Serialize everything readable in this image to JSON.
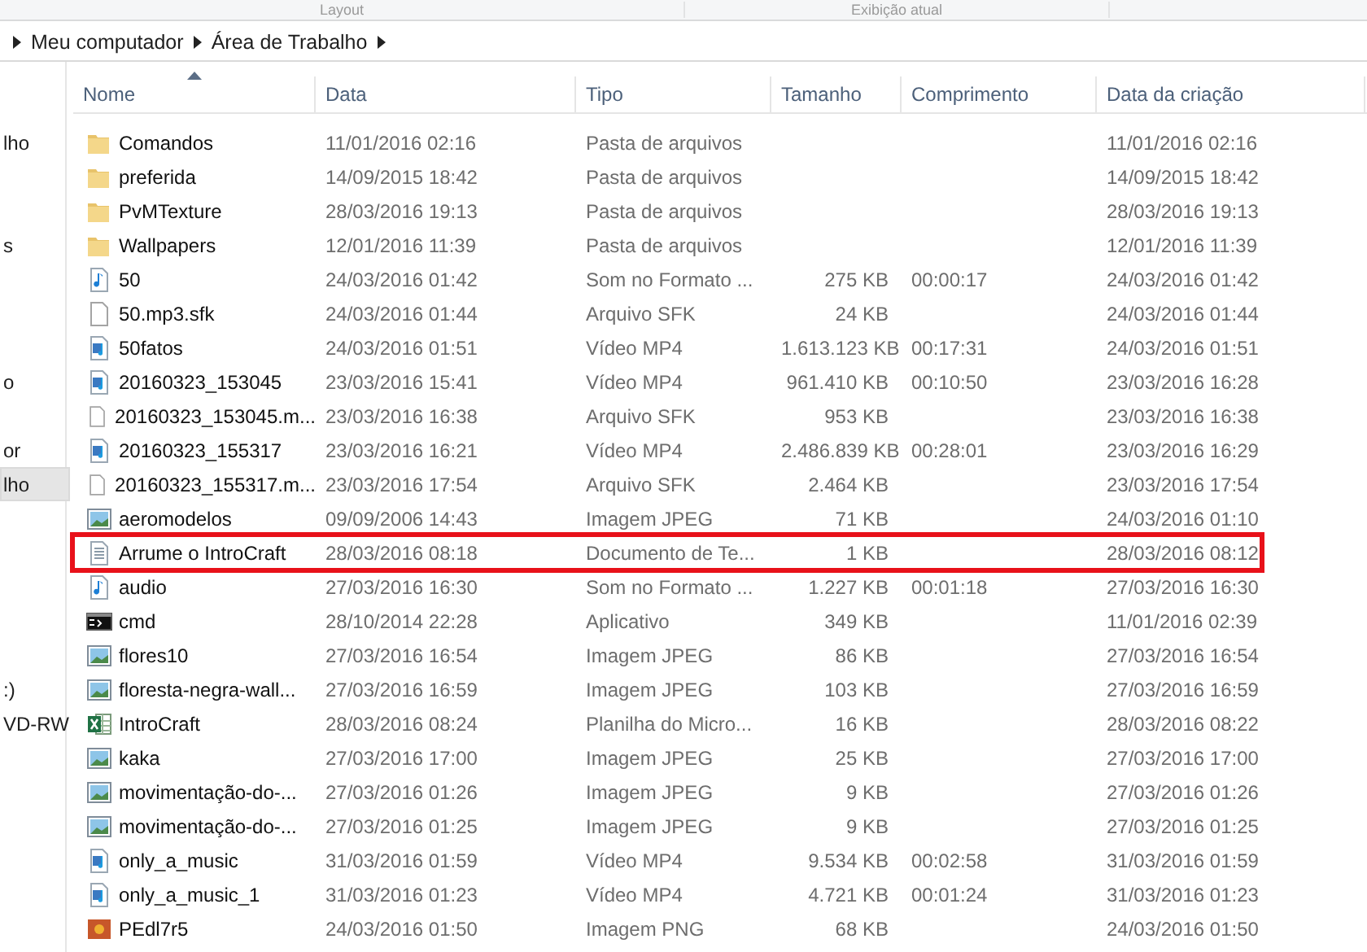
{
  "ribbon": {
    "groups": [
      "Layout",
      "Exibição atual"
    ]
  },
  "address_bar": {
    "crumbs": [
      "Meu computador",
      "Área de Trabalho"
    ]
  },
  "sidebar": {
    "items": [
      {
        "label": "lho",
        "selected": false
      },
      {
        "label": "s",
        "selected": false
      },
      {
        "label": "o",
        "selected": false
      },
      {
        "label": "or",
        "selected": false
      },
      {
        "label": "lho",
        "selected": true
      },
      {
        "label": ":)",
        "selected": false
      },
      {
        "label": "VD-RW",
        "selected": false
      }
    ]
  },
  "table": {
    "columns": [
      {
        "label": "Nome",
        "sorted": true
      },
      {
        "label": "Data",
        "sorted": false
      },
      {
        "label": "Tipo",
        "sorted": false
      },
      {
        "label": "Tamanho",
        "sorted": false
      },
      {
        "label": "Comprimento",
        "sorted": false
      },
      {
        "label": "Data da criação",
        "sorted": false
      }
    ],
    "rows": [
      {
        "kind": "folder",
        "name": "Comandos",
        "date": "11/01/2016 02:16",
        "type": "Pasta de arquivos",
        "created": "11/01/2016 02:16",
        "highlighted": false
      },
      {
        "kind": "folder",
        "name": "preferida",
        "date": "14/09/2015 18:42",
        "type": "Pasta de arquivos",
        "created": "14/09/2015 18:42",
        "highlighted": false
      },
      {
        "kind": "folder",
        "name": "PvMTexture",
        "date": "28/03/2016 19:13",
        "type": "Pasta de arquivos",
        "created": "28/03/2016 19:13",
        "highlighted": false
      },
      {
        "kind": "folder",
        "name": "Wallpapers",
        "date": "12/01/2016 11:39",
        "type": "Pasta de arquivos",
        "created": "12/01/2016 11:39",
        "highlighted": false
      },
      {
        "kind": "audio",
        "name": "50",
        "date": "24/03/2016 01:42",
        "type": "Som no Formato ...",
        "size": "275 KB",
        "length": "00:00:17",
        "created": "24/03/2016 01:42",
        "highlighted": false
      },
      {
        "kind": "blank",
        "name": "50.mp3.sfk",
        "date": "24/03/2016 01:44",
        "type": "Arquivo SFK",
        "size": "24 KB",
        "created": "24/03/2016 01:44",
        "highlighted": false
      },
      {
        "kind": "video",
        "name": "50fatos",
        "date": "24/03/2016 01:51",
        "type": "Vídeo MP4",
        "size": "1.613.123 KB",
        "length": "00:17:31",
        "created": "24/03/2016 01:51",
        "highlighted": false
      },
      {
        "kind": "video",
        "name": "20160323_153045",
        "date": "23/03/2016 15:41",
        "type": "Vídeo MP4",
        "size": "961.410 KB",
        "length": "00:10:50",
        "created": "23/03/2016 16:28",
        "highlighted": false
      },
      {
        "kind": "blank",
        "name": "20160323_153045.m...",
        "date": "23/03/2016 16:38",
        "type": "Arquivo SFK",
        "size": "953 KB",
        "created": "23/03/2016 16:38",
        "highlighted": false
      },
      {
        "kind": "video",
        "name": "20160323_155317",
        "date": "23/03/2016 16:21",
        "type": "Vídeo MP4",
        "size": "2.486.839 KB",
        "length": "00:28:01",
        "created": "23/03/2016 16:29",
        "highlighted": false
      },
      {
        "kind": "blank",
        "name": "20160323_155317.m...",
        "date": "23/03/2016 17:54",
        "type": "Arquivo SFK",
        "size": "2.464 KB",
        "created": "23/03/2016 17:54",
        "highlighted": false
      },
      {
        "kind": "image",
        "name": "aeromodelos",
        "date": "09/09/2006 14:43",
        "type": "Imagem JPEG",
        "size": "71 KB",
        "created": "24/03/2016 01:10",
        "highlighted": false
      },
      {
        "kind": "text",
        "name": "Arrume o IntroCraft",
        "date": "28/03/2016 08:18",
        "type": "Documento de Te...",
        "size": "1 KB",
        "created": "28/03/2016 08:12",
        "highlighted": true
      },
      {
        "kind": "audio",
        "name": "audio",
        "date": "27/03/2016 16:30",
        "type": "Som no Formato ...",
        "size": "1.227 KB",
        "length": "00:01:18",
        "created": "27/03/2016 16:30",
        "highlighted": false
      },
      {
        "kind": "console",
        "name": "cmd",
        "date": "28/10/2014 22:28",
        "type": "Aplicativo",
        "size": "349 KB",
        "created": "11/01/2016 02:39",
        "highlighted": false
      },
      {
        "kind": "image",
        "name": "flores10",
        "date": "27/03/2016 16:54",
        "type": "Imagem JPEG",
        "size": "86 KB",
        "created": "27/03/2016 16:54",
        "highlighted": false
      },
      {
        "kind": "image",
        "name": "floresta-negra-wall...",
        "date": "27/03/2016 16:59",
        "type": "Imagem JPEG",
        "size": "103 KB",
        "created": "27/03/2016 16:59",
        "highlighted": false
      },
      {
        "kind": "sheet",
        "name": "IntroCraft",
        "date": "28/03/2016 08:24",
        "type": "Planilha do Micro...",
        "size": "16 KB",
        "created": "28/03/2016 08:22",
        "highlighted": false
      },
      {
        "kind": "image",
        "name": "kaka",
        "date": "27/03/2016 17:00",
        "type": "Imagem JPEG",
        "size": "25 KB",
        "created": "27/03/2016 17:00",
        "highlighted": false
      },
      {
        "kind": "image",
        "name": "movimentação-do-...",
        "date": "27/03/2016 01:26",
        "type": "Imagem JPEG",
        "size": "9 KB",
        "created": "27/03/2016 01:26",
        "highlighted": false
      },
      {
        "kind": "image",
        "name": "movimentação-do-...",
        "date": "27/03/2016 01:25",
        "type": "Imagem JPEG",
        "size": "9 KB",
        "created": "27/03/2016 01:25",
        "highlighted": false
      },
      {
        "kind": "video",
        "name": "only_a_music",
        "date": "31/03/2016 01:59",
        "type": "Vídeo MP4",
        "size": "9.534 KB",
        "length": "00:02:58",
        "created": "31/03/2016 01:59",
        "highlighted": false
      },
      {
        "kind": "video",
        "name": "only_a_music_1",
        "date": "31/03/2016 01:23",
        "type": "Vídeo MP4",
        "size": "4.721 KB",
        "length": "00:01:24",
        "created": "31/03/2016 01:23",
        "highlighted": false
      },
      {
        "kind": "png",
        "name": "PEdl7r5",
        "date": "24/03/2016 01:50",
        "type": "Imagem PNG",
        "size": "68 KB",
        "created": "24/03/2016 01:50",
        "highlighted": false
      }
    ]
  }
}
